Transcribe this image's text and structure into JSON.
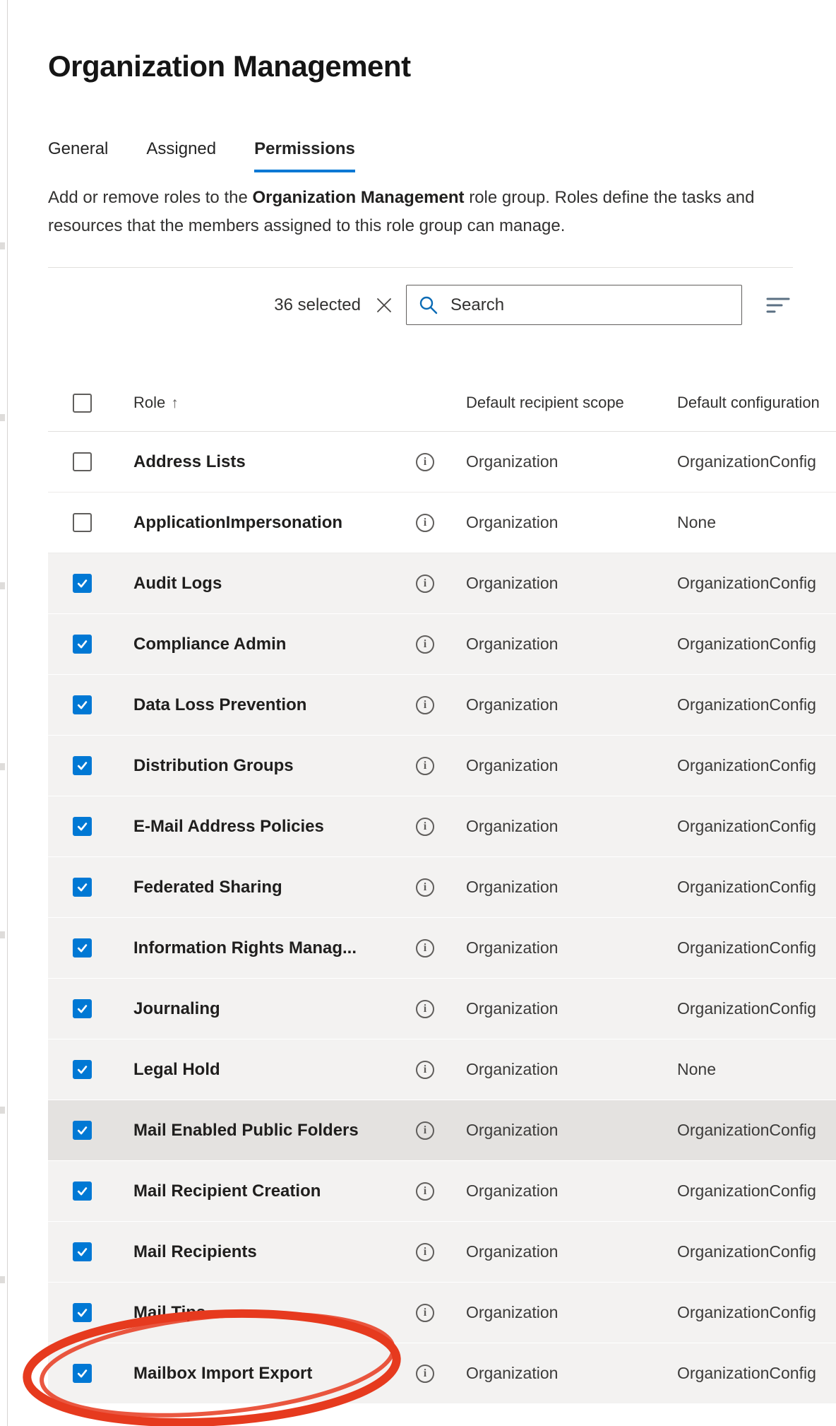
{
  "page": {
    "title": "Organization Management"
  },
  "tabs": [
    {
      "label": "General",
      "active": false
    },
    {
      "label": "Assigned",
      "active": false
    },
    {
      "label": "Permissions",
      "active": true
    }
  ],
  "description": {
    "part1": "Add or remove roles to the ",
    "bold": "Organization Management",
    "part2": " role group. Roles define the tasks and resources that the members assigned to this role group can manage."
  },
  "toolbar": {
    "selected_count_label": "36 selected",
    "search_placeholder": "Search"
  },
  "table": {
    "headers": {
      "role": "Role",
      "sort_indicator": "↑",
      "scope": "Default recipient scope",
      "config": "Default configuration"
    },
    "rows": [
      {
        "role": "Address Lists",
        "checked": false,
        "scope": "Organization",
        "config": "OrganizationConfig",
        "bg": "white"
      },
      {
        "role": "ApplicationImpersonation",
        "checked": false,
        "scope": "Organization",
        "config": "None",
        "bg": "white"
      },
      {
        "role": "Audit Logs",
        "checked": true,
        "scope": "Organization",
        "config": "OrganizationConfig",
        "bg": "gray"
      },
      {
        "role": "Compliance Admin",
        "checked": true,
        "scope": "Organization",
        "config": "OrganizationConfig",
        "bg": "gray"
      },
      {
        "role": "Data Loss Prevention",
        "checked": true,
        "scope": "Organization",
        "config": "OrganizationConfig",
        "bg": "gray"
      },
      {
        "role": "Distribution Groups",
        "checked": true,
        "scope": "Organization",
        "config": "OrganizationConfig",
        "bg": "gray"
      },
      {
        "role": "E-Mail Address Policies",
        "checked": true,
        "scope": "Organization",
        "config": "OrganizationConfig",
        "bg": "gray"
      },
      {
        "role": "Federated Sharing",
        "checked": true,
        "scope": "Organization",
        "config": "OrganizationConfig",
        "bg": "gray"
      },
      {
        "role": "Information Rights Manag...",
        "checked": true,
        "scope": "Organization",
        "config": "OrganizationConfig",
        "bg": "gray"
      },
      {
        "role": "Journaling",
        "checked": true,
        "scope": "Organization",
        "config": "OrganizationConfig",
        "bg": "gray"
      },
      {
        "role": "Legal Hold",
        "checked": true,
        "scope": "Organization",
        "config": "None",
        "bg": "gray"
      },
      {
        "role": "Mail Enabled Public Folders",
        "checked": true,
        "scope": "Organization",
        "config": "OrganizationConfig",
        "bg": "darker"
      },
      {
        "role": "Mail Recipient Creation",
        "checked": true,
        "scope": "Organization",
        "config": "OrganizationConfig",
        "bg": "gray"
      },
      {
        "role": "Mail Recipients",
        "checked": true,
        "scope": "Organization",
        "config": "OrganizationConfig",
        "bg": "gray"
      },
      {
        "role": "Mail Tips",
        "checked": true,
        "scope": "Organization",
        "config": "OrganizationConfig",
        "bg": "gray"
      },
      {
        "role": "Mailbox Import Export",
        "checked": true,
        "scope": "Organization",
        "config": "OrganizationConfig",
        "bg": "gray"
      }
    ]
  },
  "icons": {
    "search": "magnifier",
    "clear_selection": "x-dismiss",
    "filter": "filter-lines",
    "sort": "arrow-up",
    "info": "info-circle",
    "checked": "checkmark"
  },
  "colors": {
    "accent": "#0078d4",
    "row_alt": "#f3f2f1",
    "row_highlight": "#e4e2e0",
    "annotation_red": "#e63a1e"
  }
}
